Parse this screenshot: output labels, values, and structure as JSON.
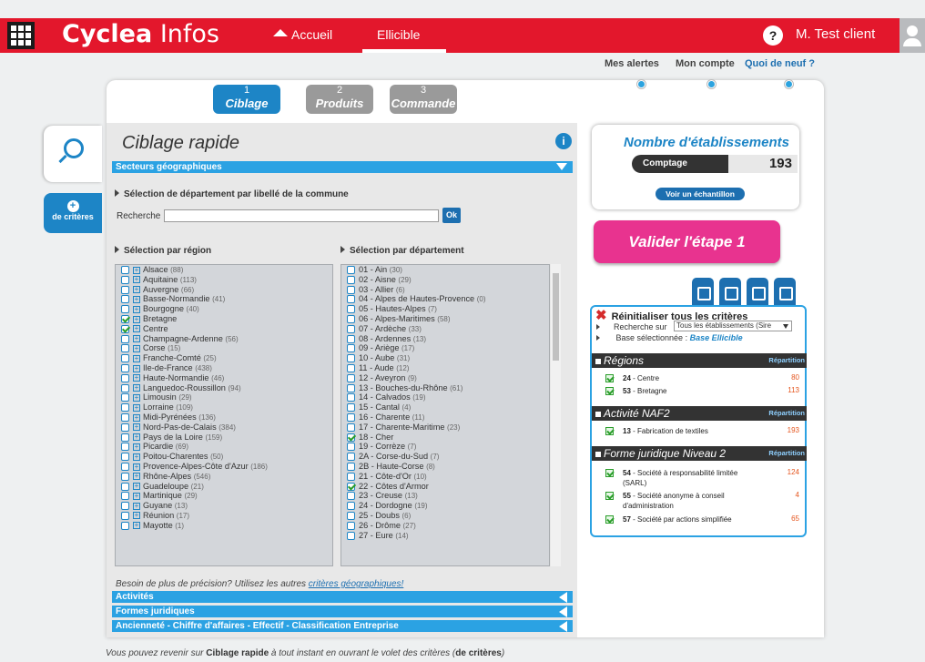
{
  "topbar": {
    "brand_bold": "Cyclea",
    "brand_light": "Infos",
    "nav_home": "Accueil",
    "nav_ellicible": "Ellicible",
    "user": "M. Test client"
  },
  "sublinks": [
    "Mes alertes",
    "Mon compte",
    "Quoi de neuf ?"
  ],
  "steps": [
    {
      "num": "1",
      "label": "Ciblage"
    },
    {
      "num": "2",
      "label": "Produits"
    },
    {
      "num": "3",
      "label": "Commande"
    }
  ],
  "side": {
    "crit_label": "de critères",
    "crit_plus": "+"
  },
  "panel": {
    "title": "Ciblage rapide",
    "info": "i",
    "secteurs": "Secteurs géographiques",
    "commune_title": "Sélection de département par libellé de la commune",
    "recherche_label": "Recherche",
    "ok": "Ok",
    "region_title": "Sélection par région",
    "dept_title": "Sélection par département",
    "precision_text": "Besoin de plus de précision? Utilisez les autres ",
    "precision_link": "critères géographiques!",
    "bars": [
      "Activités",
      "Formes juridiques",
      "Ancienneté - Chiffre d'affaires - Effectif - Classification Entreprise"
    ]
  },
  "regions": [
    {
      "name": "Alsace",
      "count": "(88)",
      "checked": false
    },
    {
      "name": "Aquitaine",
      "count": "(113)",
      "checked": false
    },
    {
      "name": "Auvergne",
      "count": "(66)",
      "checked": false
    },
    {
      "name": "Basse-Normandie",
      "count": "(41)",
      "checked": false
    },
    {
      "name": "Bourgogne",
      "count": "(40)",
      "checked": false
    },
    {
      "name": "Bretagne",
      "count": "",
      "checked": true
    },
    {
      "name": "Centre",
      "count": "",
      "checked": true
    },
    {
      "name": "Champagne-Ardenne",
      "count": "(56)",
      "checked": false
    },
    {
      "name": "Corse",
      "count": "(15)",
      "checked": false
    },
    {
      "name": "Franche-Comté",
      "count": "(25)",
      "checked": false
    },
    {
      "name": "Ile-de-France",
      "count": "(438)",
      "checked": false
    },
    {
      "name": "Haute-Normandie",
      "count": "(46)",
      "checked": false
    },
    {
      "name": "Languedoc-Roussillon",
      "count": "(94)",
      "checked": false
    },
    {
      "name": "Limousin",
      "count": "(29)",
      "checked": false
    },
    {
      "name": "Lorraine",
      "count": "(109)",
      "checked": false
    },
    {
      "name": "Midi-Pyrénées",
      "count": "(136)",
      "checked": false
    },
    {
      "name": "Nord-Pas-de-Calais",
      "count": "(384)",
      "checked": false
    },
    {
      "name": "Pays de la Loire",
      "count": "(159)",
      "checked": false
    },
    {
      "name": "Picardie",
      "count": "(69)",
      "checked": false
    },
    {
      "name": "Poitou-Charentes",
      "count": "(50)",
      "checked": false
    },
    {
      "name": "Provence-Alpes-Côte d'Azur",
      "count": "(186)",
      "checked": false
    },
    {
      "name": "Rhône-Alpes",
      "count": "(546)",
      "checked": false
    },
    {
      "name": "Guadeloupe",
      "count": "(21)",
      "checked": false
    },
    {
      "name": "Martinique",
      "count": "(29)",
      "checked": false
    },
    {
      "name": "Guyane",
      "count": "(13)",
      "checked": false
    },
    {
      "name": "Réunion",
      "count": "(17)",
      "checked": false
    },
    {
      "name": "Mayotte",
      "count": "(1)",
      "checked": false
    }
  ],
  "departements": [
    {
      "name": "01 - Ain",
      "count": "(30)",
      "checked": false
    },
    {
      "name": "02 - Aisne",
      "count": "(29)",
      "checked": false
    },
    {
      "name": "03 - Allier",
      "count": "(6)",
      "checked": false
    },
    {
      "name": "04 - Alpes de Hautes-Provence",
      "count": "(0)",
      "checked": false
    },
    {
      "name": "05 - Hautes-Alpes",
      "count": "(7)",
      "checked": false
    },
    {
      "name": "06 - Alpes-Maritimes",
      "count": "(58)",
      "checked": false
    },
    {
      "name": "07 - Ardèche",
      "count": "(33)",
      "checked": false
    },
    {
      "name": "08 - Ardennes",
      "count": "(13)",
      "checked": false
    },
    {
      "name": "09 - Ariège",
      "count": "(17)",
      "checked": false
    },
    {
      "name": "10 - Aube",
      "count": "(31)",
      "checked": false
    },
    {
      "name": "11 - Aude",
      "count": "(12)",
      "checked": false
    },
    {
      "name": "12 - Aveyron",
      "count": "(9)",
      "checked": false
    },
    {
      "name": "13 - Bouches-du-Rhône",
      "count": "(61)",
      "checked": false
    },
    {
      "name": "14 - Calvados",
      "count": "(19)",
      "checked": false
    },
    {
      "name": "15 - Cantal",
      "count": "(4)",
      "checked": false
    },
    {
      "name": "16 - Charente",
      "count": "(11)",
      "checked": false
    },
    {
      "name": "17 - Charente-Maritime",
      "count": "(23)",
      "checked": false
    },
    {
      "name": "18 - Cher",
      "count": "",
      "checked": true
    },
    {
      "name": "19 - Corrèze",
      "count": "(7)",
      "checked": false
    },
    {
      "name": "2A - Corse-du-Sud",
      "count": "(7)",
      "checked": false
    },
    {
      "name": "2B - Haute-Corse",
      "count": "(8)",
      "checked": false
    },
    {
      "name": "21 - Côte-d'Or",
      "count": "(10)",
      "checked": false
    },
    {
      "name": "22 - Côtes d'Armor",
      "count": "",
      "checked": true
    },
    {
      "name": "23 - Creuse",
      "count": "(13)",
      "checked": false
    },
    {
      "name": "24 - Dordogne",
      "count": "(19)",
      "checked": false
    },
    {
      "name": "25 - Doubs",
      "count": "(6)",
      "checked": false
    },
    {
      "name": "26 - Drôme",
      "count": "(27)",
      "checked": false
    },
    {
      "name": "27 - Eure",
      "count": "(14)",
      "checked": false
    }
  ],
  "count_card": {
    "title": "Nombre d'établissements",
    "comptage": "Comptage",
    "value": "193",
    "sample": "Voir un échantillon"
  },
  "validate": "Valider l'étape 1",
  "criteria": {
    "reset": "Réinitialiser tous les critères",
    "recherche_label": "Recherche sur",
    "recherche_value": "Tous les établissements (Sire",
    "base_label": "Base sélectionnée : ",
    "base_value": "Base Ellicible",
    "repartition": "Répartition",
    "groups": [
      {
        "title": "Régions",
        "rows": [
          {
            "code": "24",
            "label": " - Centre",
            "value": "80"
          },
          {
            "code": "53",
            "label": " - Bretagne",
            "value": "113"
          }
        ]
      },
      {
        "title": "Activité NAF2",
        "rows": [
          {
            "code": "13",
            "label": " - Fabrication de textiles",
            "value": "193"
          }
        ]
      },
      {
        "title": "Forme juridique Niveau 2",
        "rows": [
          {
            "code": "54",
            "label": " - Société à responsabilité limitée (SARL)",
            "value": "124"
          },
          {
            "code": "55",
            "label": " - Société anonyme à conseil d'administration",
            "value": "4"
          },
          {
            "code": "57",
            "label": " - Société par actions simplifiée",
            "value": "65"
          }
        ]
      }
    ]
  },
  "footer": {
    "before": "Vous pouvez revenir sur ",
    "link1": "Ciblage rapide",
    "middle": " à tout instant en ouvrant le volet des critères (",
    "link2": "de critères",
    "after": ")"
  },
  "colors": {
    "brand_red": "#e3172c",
    "accent_blue": "#1d85c6",
    "validate_pink": "#e8338f"
  }
}
